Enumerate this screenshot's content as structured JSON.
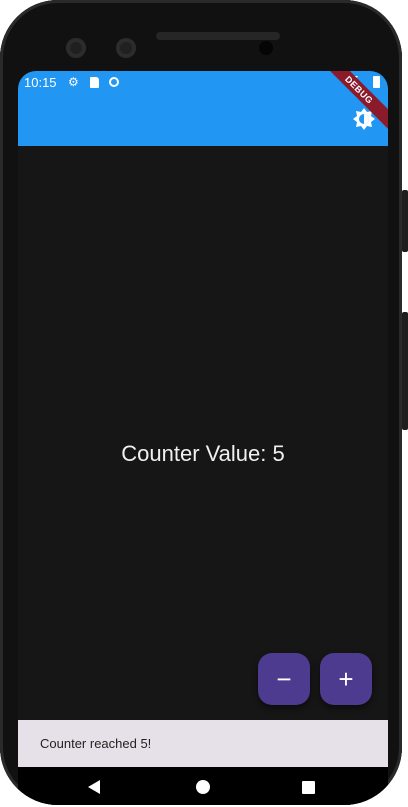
{
  "status_bar": {
    "time": "10:15",
    "icons": [
      "gear-icon",
      "sd-card-icon",
      "sync-icon",
      "wifi-icon",
      "battery-icon"
    ]
  },
  "app_bar": {
    "background_color": "#2196f3",
    "actions": [
      "brightness-icon"
    ]
  },
  "debug_banner": {
    "label": "DEBUG"
  },
  "main": {
    "counter_label": "Counter Value: 5"
  },
  "fabs": {
    "decrement_label": "−",
    "increment_label": "+",
    "color": "#4c3b8f"
  },
  "snackbar": {
    "message": "Counter reached 5!"
  },
  "nav_bar": {
    "icons": [
      "back-icon",
      "home-icon",
      "recents-icon"
    ]
  }
}
